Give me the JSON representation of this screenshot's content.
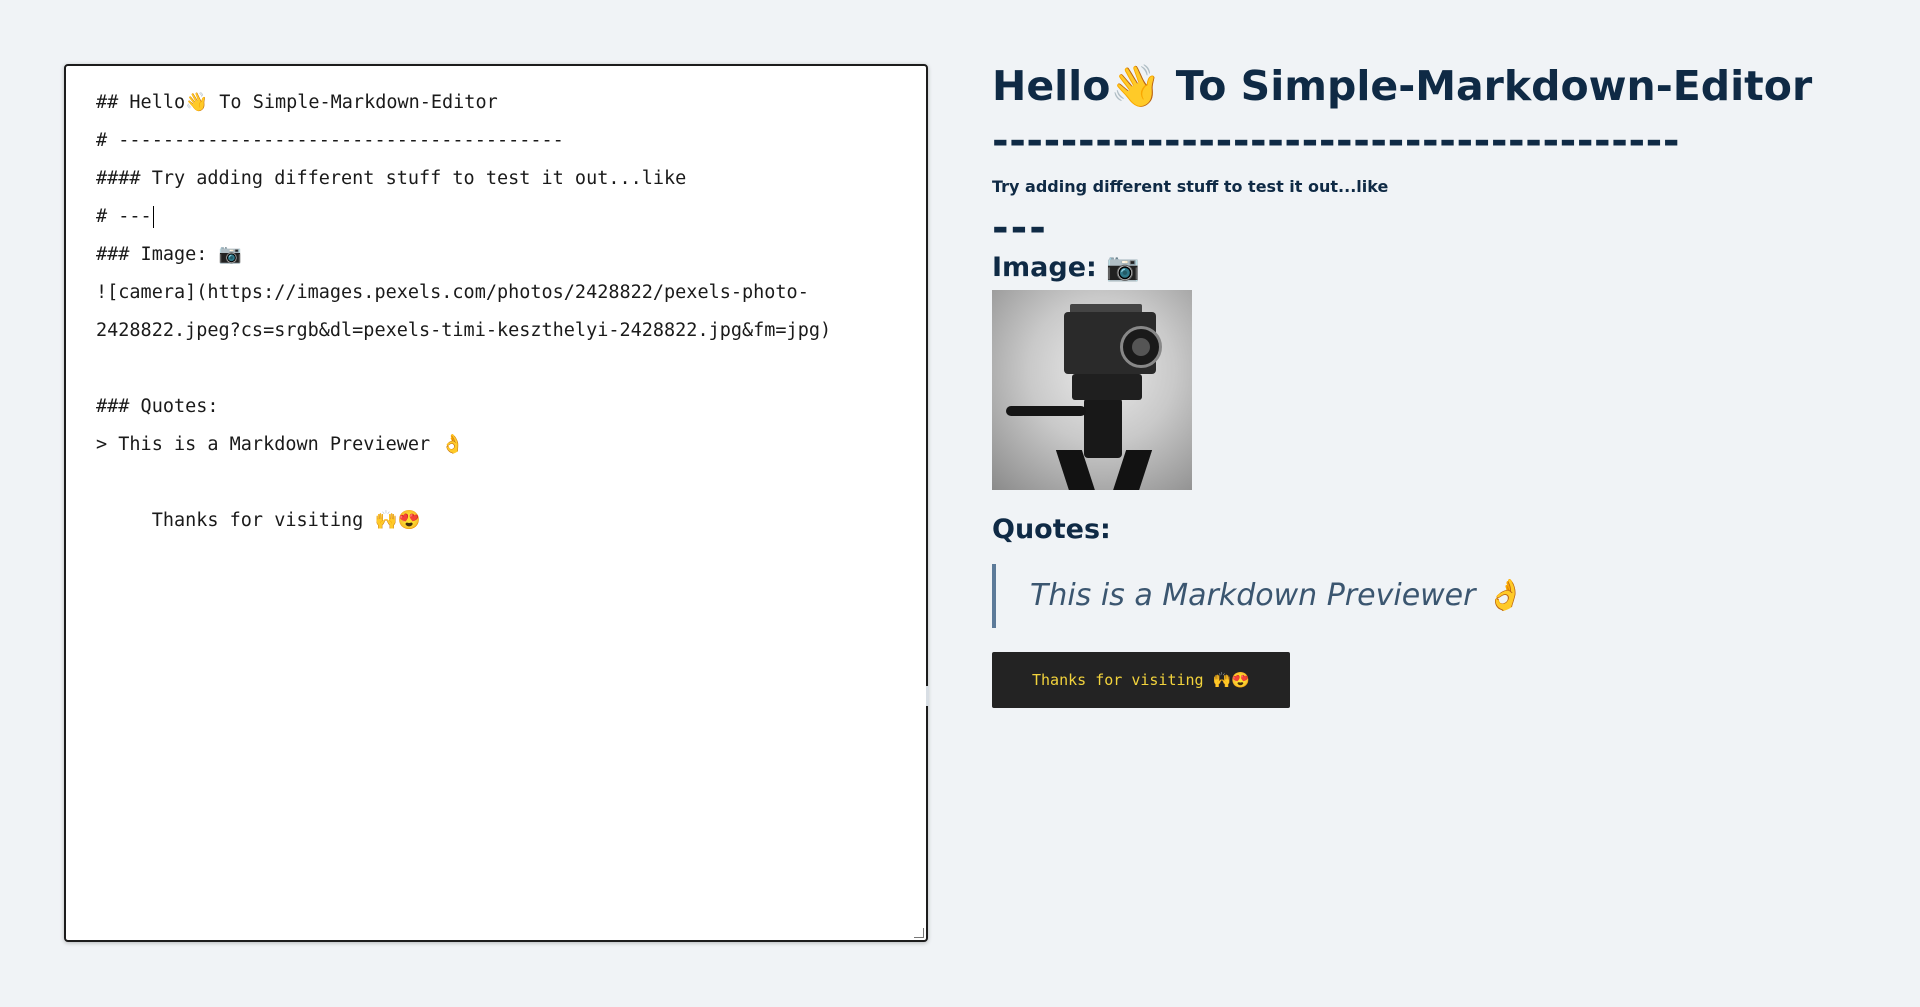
{
  "editor": {
    "lines": [
      "## Hello👋 To Simple-Markdown-Editor",
      "# ----------------------------------------",
      "#### Try adding different stuff to test it out...like",
      "# ---",
      "### Image: 📷",
      "![camera](https://images.pexels.com/photos/2428822/pexels-photo-",
      "2428822.jpeg?cs=srgb&dl=pexels-timi-keszthelyi-2428822.jpg&fm=jpg)",
      "",
      "### Quotes:",
      "> This is a Markdown Previewer 👌",
      "",
      "     Thanks for visiting 🙌😍"
    ]
  },
  "preview": {
    "heading": "Hello👋 To Simple-Markdown-Editor",
    "rule_text": "----------------------------------------",
    "subheading": "Try adding different stuff to test it out...like",
    "rule_short": "---",
    "image_heading": "Image: 📷",
    "image_alt": "camera",
    "quotes_heading": "Quotes:",
    "quote": "This is a Markdown Previewer 👌",
    "code": "Thanks for visiting 🙌😍"
  }
}
